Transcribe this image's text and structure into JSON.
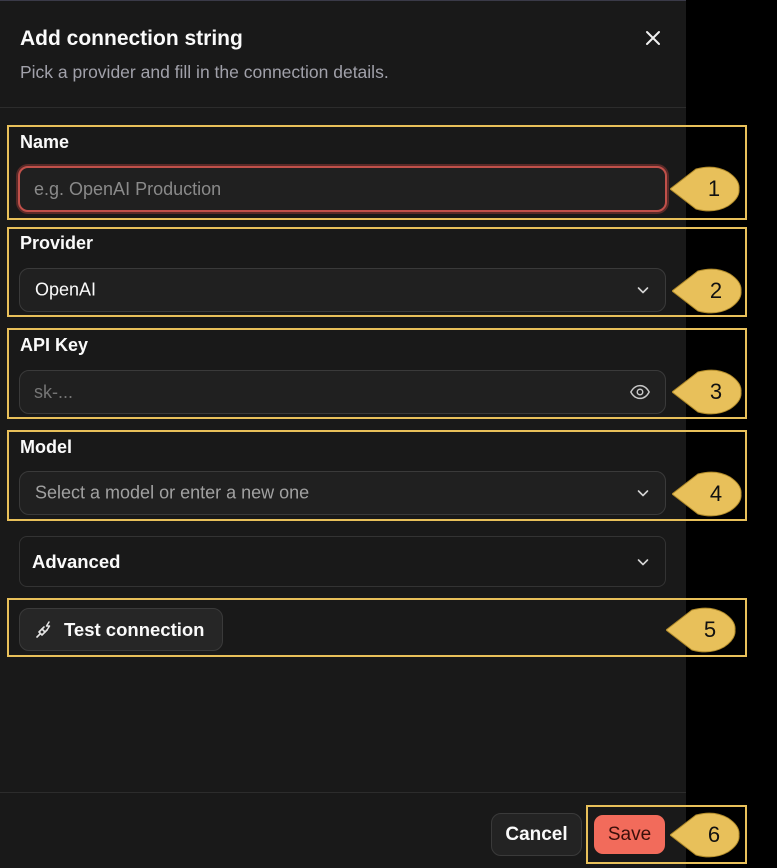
{
  "dialog": {
    "title": "Add connection string",
    "subtitle": "Pick a provider and fill in the connection details."
  },
  "fields": {
    "name": {
      "label": "Name",
      "placeholder": "e.g. OpenAI Production",
      "value": ""
    },
    "provider": {
      "label": "Provider",
      "value": "OpenAI"
    },
    "api_key": {
      "label": "API Key",
      "placeholder": "sk-...",
      "value": ""
    },
    "model": {
      "label": "Model",
      "placeholder": "Select a model or enter a new one"
    }
  },
  "advanced": {
    "label": "Advanced"
  },
  "test_connection": {
    "label": "Test connection"
  },
  "footer": {
    "cancel_label": "Cancel",
    "save_label": "Save"
  },
  "callouts": [
    "1",
    "2",
    "3",
    "4",
    "5",
    "6"
  ],
  "colors": {
    "accent_save": "#f26b5b",
    "highlight": "#e8c05a",
    "focus_ring": "#c0504a",
    "background": "#191919"
  },
  "icons": {
    "close": "close-icon",
    "chevron": "chevron-down-icon",
    "eye": "eye-icon",
    "plug": "plug-zap-icon"
  }
}
